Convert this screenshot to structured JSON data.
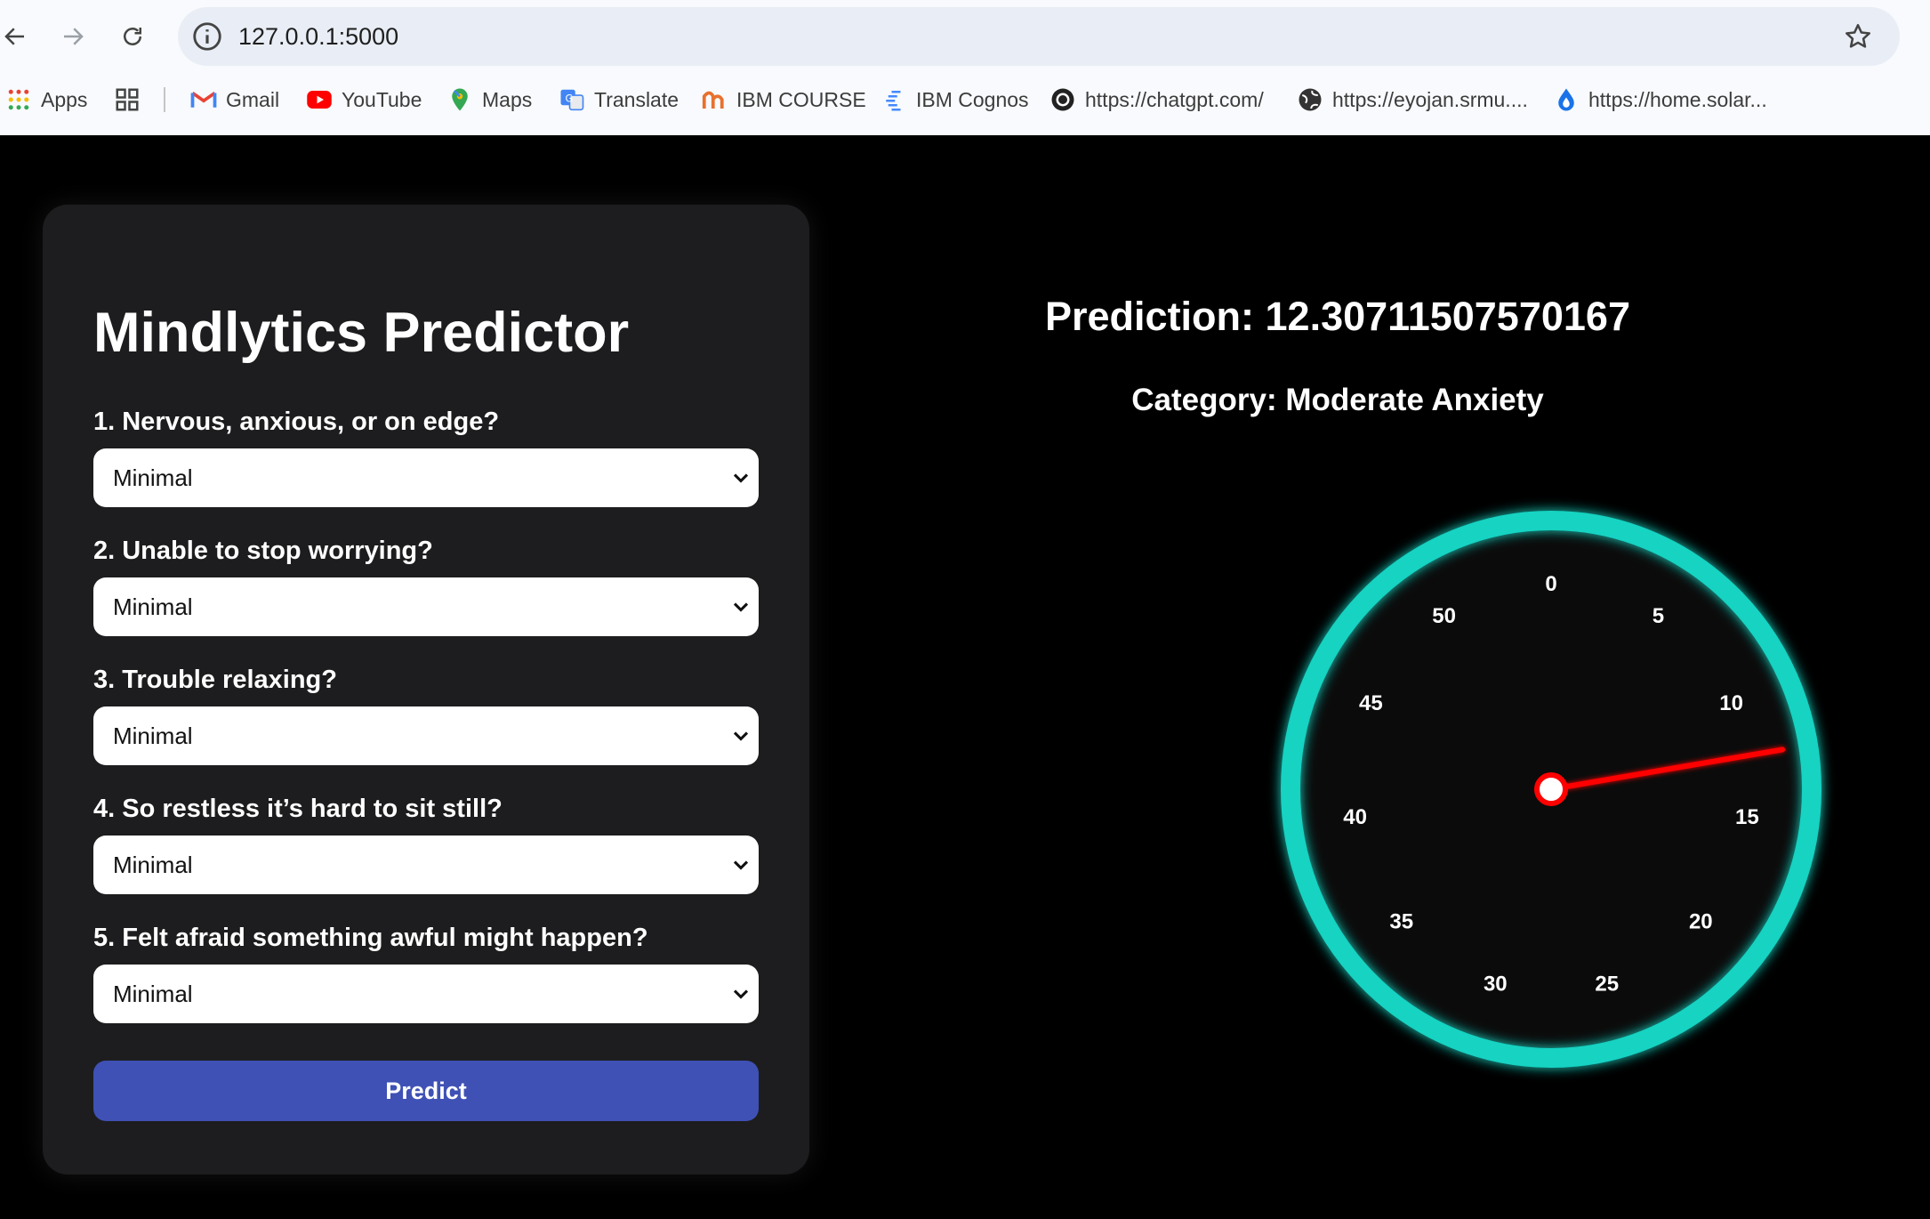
{
  "browser": {
    "url": "127.0.0.1:5000",
    "bookmarks": [
      {
        "label": "Apps",
        "icon": "apps-grid-icon"
      },
      {
        "label": "",
        "icon": "tab-groups-icon"
      },
      {
        "label": "Gmail",
        "icon": "gmail-icon"
      },
      {
        "label": "YouTube",
        "icon": "youtube-icon"
      },
      {
        "label": "Maps",
        "icon": "maps-icon"
      },
      {
        "label": "Translate",
        "icon": "translate-icon"
      },
      {
        "label": "IBM COURSE",
        "icon": "ibm-course-icon"
      },
      {
        "label": "IBM Cognos",
        "icon": "ibm-cognos-icon"
      },
      {
        "label": "https://chatgpt.com/",
        "icon": "chatgpt-icon"
      },
      {
        "label": "https://eyojan.srmu....",
        "icon": "globe-icon"
      },
      {
        "label": "https://home.solar...",
        "icon": "solar-icon"
      }
    ]
  },
  "form": {
    "title": "Mindlytics Predictor",
    "questions": [
      {
        "label": "1. Nervous, anxious, or on edge?",
        "value": "Minimal"
      },
      {
        "label": "2. Unable to stop worrying?",
        "value": "Minimal"
      },
      {
        "label": "3. Trouble relaxing?",
        "value": "Minimal"
      },
      {
        "label": "4. So restless it’s hard to sit still?",
        "value": "Minimal"
      },
      {
        "label": "5. Felt afraid something awful might happen?",
        "value": "Minimal"
      }
    ],
    "submit_label": "Predict"
  },
  "result": {
    "prediction_text": "Prediction: 12.30711507570167",
    "category_text": "Category: Moderate Anxiety"
  },
  "gauge": {
    "value": 12.30711507570167,
    "min": 0,
    "max": 55,
    "tick_labels": [
      "0",
      "5",
      "10",
      "15",
      "20",
      "25",
      "30",
      "35",
      "40",
      "45",
      "50"
    ],
    "ring_color": "#14d3c2",
    "needle_color": "#ff0000",
    "face_color": "#0b0b0b"
  }
}
